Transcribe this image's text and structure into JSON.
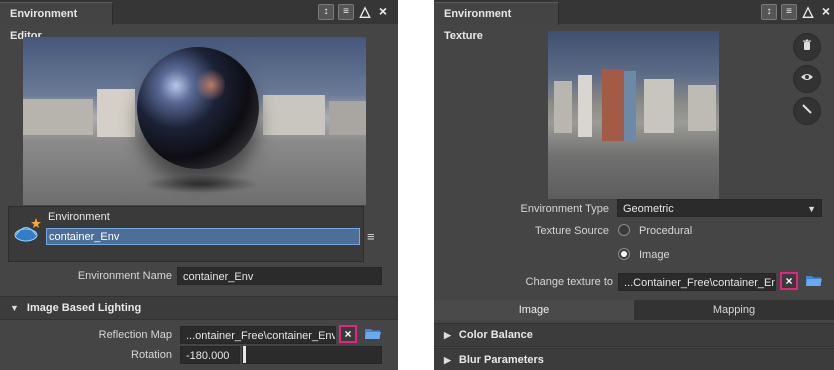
{
  "colors": {
    "panel_bg": "#454545",
    "highlight": "#e8237f",
    "selection": "#4c6e99"
  },
  "left_panel": {
    "title": "Environment Editor",
    "title_icons": [
      "↕",
      "≡",
      "△"
    ],
    "close": "×",
    "environment_label": "Environment",
    "environment_input_value": "container_Env",
    "menu_icon": "≡",
    "env_name_label": "Environment Name",
    "env_name_value": "container_Env",
    "ibl_section": "Image Based Lighting",
    "reflection_map_label": "Reflection Map",
    "reflection_map_value": "...ontainer_Free\\container_Env.hdr",
    "clear_symbol": "×",
    "rotation_label": "Rotation",
    "rotation_value": "-180.000"
  },
  "right_panel": {
    "title": "Environment Texture",
    "title_icons": [
      "↕",
      "≡",
      "△"
    ],
    "close": "×",
    "side_buttons": [
      "trash-icon",
      "eye-icon",
      "wand-icon"
    ],
    "env_type_label": "Environment Type",
    "env_type_value": "Geometric",
    "texture_source_label": "Texture Source",
    "radio_procedural": "Procedural",
    "radio_image": "Image",
    "texture_source_selected": "Image",
    "change_texture_label": "Change texture to",
    "change_texture_value": "...Container_Free\\container_Env.hdr",
    "clear_symbol": "×",
    "tabs": [
      {
        "label": "Image",
        "active": true
      },
      {
        "label": "Mapping",
        "active": false
      }
    ],
    "sections": [
      "Color Balance",
      "Blur Parameters"
    ]
  }
}
